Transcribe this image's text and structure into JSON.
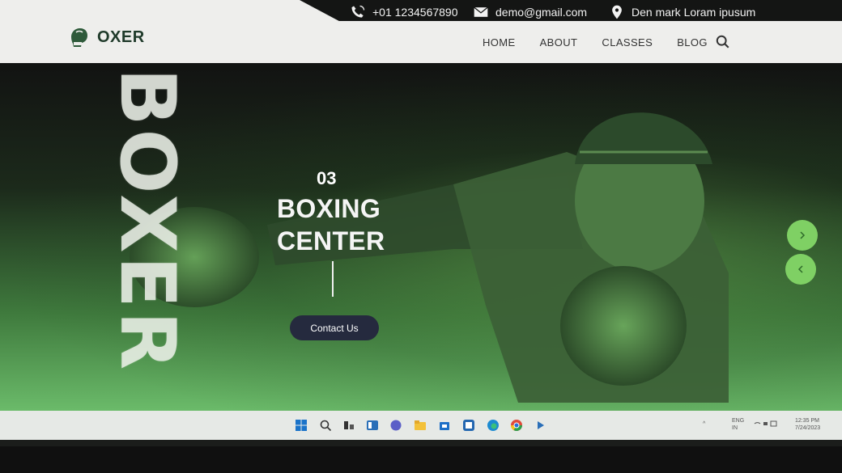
{
  "topbar": {
    "phone": "+01 1234567890",
    "email": "demo@gmail.com",
    "location": "Den mark Loram ipusum"
  },
  "header": {
    "logo_text": "OXER",
    "nav": [
      "HOME",
      "ABOUT",
      "CLASSES",
      "BLOG"
    ]
  },
  "hero": {
    "vertical_word": "BOXER",
    "slide_number": "03",
    "title_line1": "BOXING",
    "title_line2": "CENTER",
    "cta_label": "Contact Us"
  },
  "taskbar": {
    "lang_line1": "ENG",
    "lang_line2": "IN",
    "time": "12:35 PM",
    "date": "7/24/2023"
  },
  "colors": {
    "accent_green": "#7fd064",
    "button_dark": "#252a3e",
    "logo_green": "#1f3a2a"
  }
}
